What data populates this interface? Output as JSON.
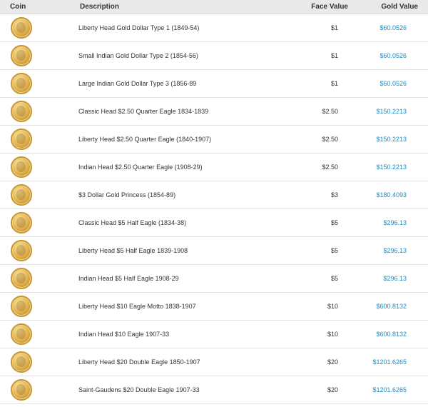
{
  "header": {
    "coin": "Coin",
    "description": "Description",
    "face_value": "Face Value",
    "gold_value": "Gold Value"
  },
  "colors": {
    "link": "#1e8bc3",
    "header_bg": "#e9e9e9"
  },
  "rows": [
    {
      "description": "Liberty Head Gold Dollar Type 1 (1849-54)",
      "face": "$1",
      "gold": "$60.0526"
    },
    {
      "description": "Small Indian Gold Dollar Type 2 (1854-56)",
      "face": "$1",
      "gold": "$60.0526"
    },
    {
      "description": "Large Indian Gold Dollar Type 3 (1856-89",
      "face": "$1",
      "gold": "$60.0526"
    },
    {
      "description": "Classic Head $2.50 Quarter Eagle 1834-1839",
      "face": "$2.50",
      "gold": "$150.2213"
    },
    {
      "description": "Liberty Head $2.50 Quarter Eagle (1840-1907)",
      "face": "$2.50",
      "gold": "$150.2213"
    },
    {
      "description": "Indian Head $2.50 Quarter Eagle (1908-29)",
      "face": "$2.50",
      "gold": "$150.2213"
    },
    {
      "description": "$3 Dollar Gold Princess (1854-89)",
      "face": "$3",
      "gold": "$180.4093"
    },
    {
      "description": "Classic Head $5 Half Eagle (1834-38)",
      "face": "$5",
      "gold": "$296.13"
    },
    {
      "description": "Liberty Head $5 Half Eagle 1839-1908",
      "face": "$5",
      "gold": "$296.13"
    },
    {
      "description": "Indian Head $5 Half Eagle 1908-29",
      "face": "$5",
      "gold": "$296.13"
    },
    {
      "description": "Liberty Head $10 Eagle Motto 1838-1907",
      "face": "$10",
      "gold": "$600.8132"
    },
    {
      "description": "Indian Head $10 Eagle 1907-33",
      "face": "$10",
      "gold": "$600.8132"
    },
    {
      "description": "Liberty Head $20 Double Eagle 1850-1907",
      "face": "$20",
      "gold": "$1201.6265"
    },
    {
      "description": "Saint-Gaudens $20 Double Eagle 1907-33",
      "face": "$20",
      "gold": "$1201.6265"
    }
  ]
}
